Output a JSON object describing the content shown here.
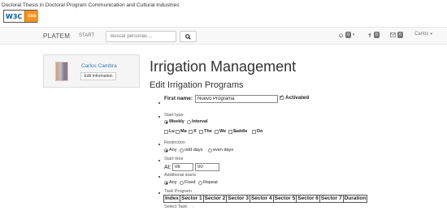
{
  "top_caption": "Doctoral Thesis in Doctoral Program Communication and Cultural Industries",
  "badge": {
    "w3c": "W3C",
    "css": "css"
  },
  "navbar": {
    "brand": "PLATEM",
    "start": "START",
    "search_placeholder": "Buscar personas ...",
    "notifications_count": "0",
    "uploads_count": "0",
    "messages_count": "0",
    "user": "Carlos"
  },
  "profile": {
    "name": "Carlos Cambra",
    "edit_button": "Edit Information"
  },
  "main": {
    "title": "Irrigation Management",
    "subtitle": "Edit Irrigation Programs"
  },
  "form": {
    "first_name_label": "First name:",
    "first_name_value": "Nuevo Programa",
    "activated_label": "Activated",
    "start_type_label": "Start type",
    "start_type_options": [
      "Weekly",
      "Interval"
    ],
    "days": [
      "Lu",
      "Ma",
      "X",
      "The",
      "We",
      "$addle",
      "Do"
    ],
    "restriction_label": "Restriction",
    "restriction_options": [
      "Any",
      "odd days",
      "even days"
    ],
    "start_time_label": "Start time",
    "start_time_prefix": "At:",
    "start_hour": "06",
    "start_minute": "00",
    "additional_starts_label": "Additional starts",
    "additional_starts_options": [
      "Any",
      "Fixed",
      "Repeat"
    ],
    "task_program_label": "Task Program",
    "task_columns": [
      "Index",
      "Sector 1",
      "Sector 2",
      "Sector 3",
      "Sector 4",
      "Sector 5",
      "Sector 6",
      "Sector 7",
      "Duration"
    ],
    "select_task_label": "Select Task:",
    "select_task_value": "-"
  }
}
